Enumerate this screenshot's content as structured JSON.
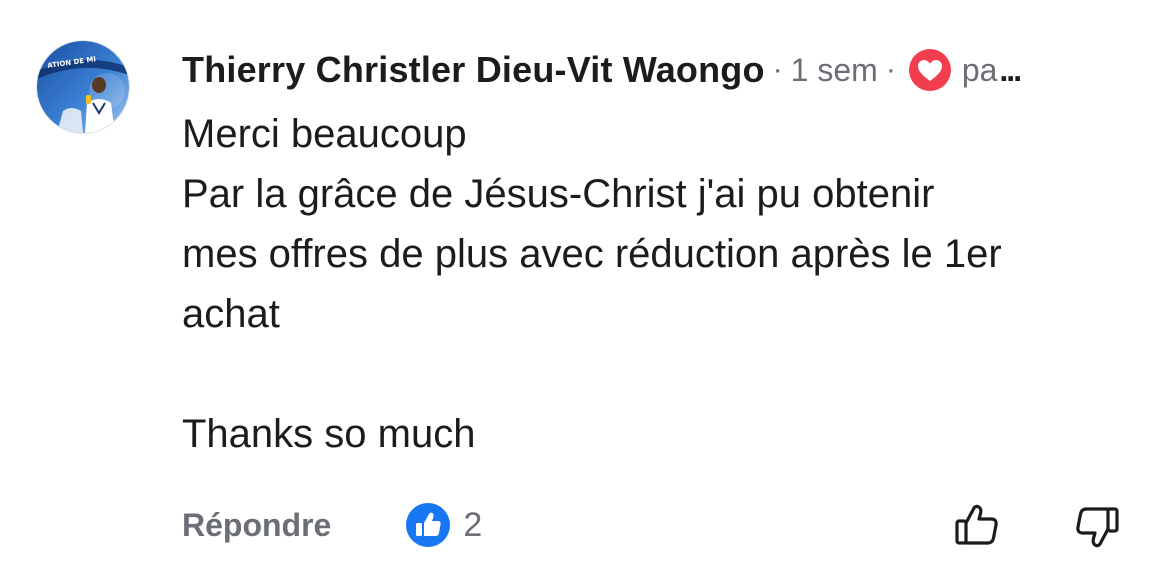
{
  "comment": {
    "author": "Thierry Christler Dieu-Vit Waongo",
    "separator": "·",
    "time": "1 sem",
    "badge_text": "pa",
    "more": "...",
    "body_lines": [
      "Merci beaucoup",
      "Par la grâce de Jésus-Christ j'ai pu obtenir",
      "mes offres de plus avec réduction après le 1er",
      "achat",
      "",
      "Thanks so much"
    ],
    "avatar_banner_text": "ATION DE MI"
  },
  "actions": {
    "reply_label": "Répondre",
    "like_count": "2"
  },
  "colors": {
    "like_blue": "#1877F2",
    "heart_red": "#F23D4F",
    "muted_gray": "#6B6F75"
  },
  "icons": {
    "reactions": [
      "heart-icon",
      "like-icon"
    ],
    "votes": [
      "thumbs-up-outline-icon",
      "thumbs-down-outline-icon"
    ]
  }
}
